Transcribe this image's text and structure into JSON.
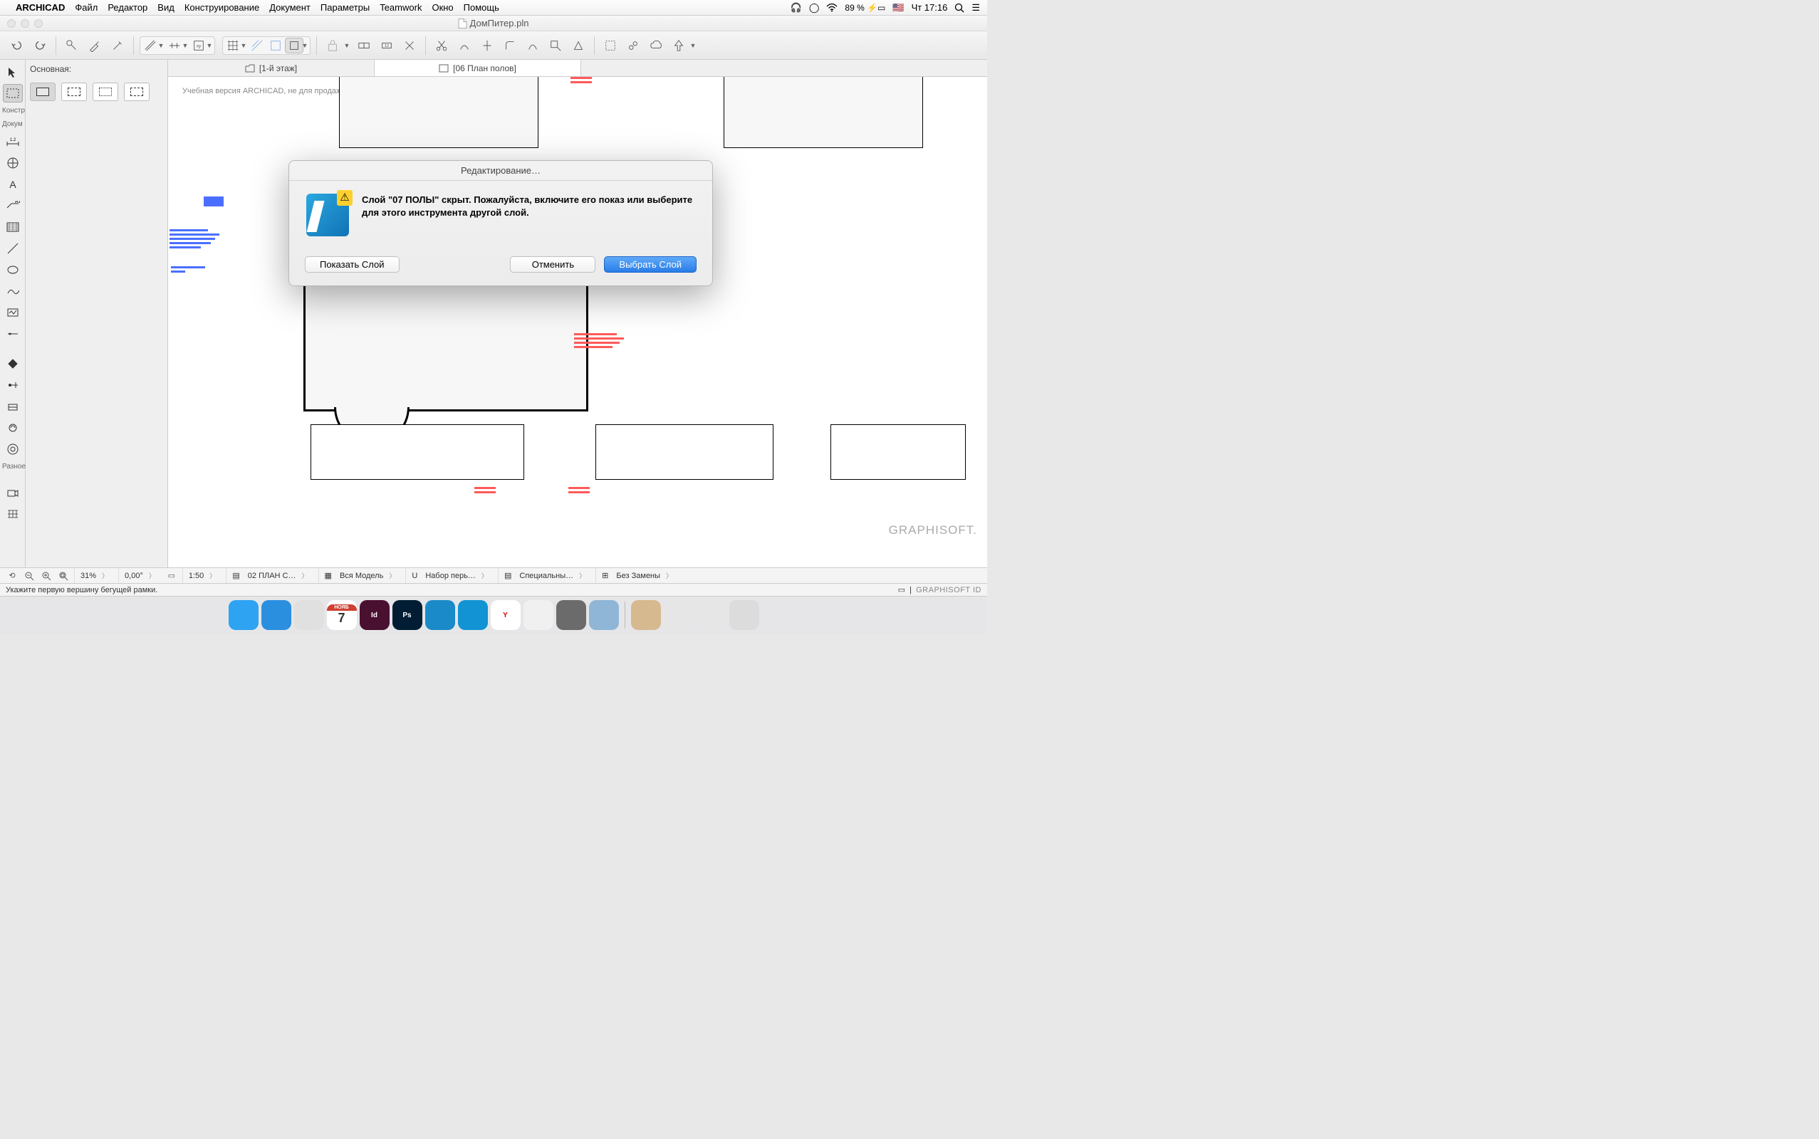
{
  "menubar": {
    "app": "ARCHICAD",
    "items": [
      "Файл",
      "Редактор",
      "Вид",
      "Конструирование",
      "Документ",
      "Параметры",
      "Teamwork",
      "Окно",
      "Помощь"
    ],
    "battery": "89 %",
    "clock": "Чт 17:16"
  },
  "window": {
    "title": "ДомПитер.pln"
  },
  "tabs": [
    {
      "icon": "folder-icon",
      "label": "[1-й этаж]"
    },
    {
      "icon": "sheet-icon",
      "label": "[06 План полов]"
    }
  ],
  "infobar": {
    "title": "Основная:"
  },
  "left_labels": {
    "constr": "Констр",
    "doc": "Докум",
    "misc": "Разное"
  },
  "canvas": {
    "watermark": "Учебная версия ARCHICAD, не для продажи. В порядке любезности GRAPHISOFT.",
    "graphisoft": "GRAPHISOFT."
  },
  "dialog": {
    "title": "Редактирование…",
    "message": "Слой \"07 ПОЛЫ\" скрыт. Пожалуйста, включите его показ или выберите для этого инструмента другой слой.",
    "btn_show": "Показать Слой",
    "btn_cancel": "Отменить",
    "btn_select": "Выбрать Слой"
  },
  "quickbar": {
    "zoom": "31%",
    "angle": "0,00°",
    "scale": "1:50",
    "layer": "02 ПЛАН С…",
    "model": "Вся Модель",
    "penset": "Набор перь…",
    "mvo": "Специальны…",
    "reno": "Без Замены"
  },
  "status": {
    "hint": "Укажите первую вершину бегущей рамки.",
    "id": "GRAPHISOFT ID"
  },
  "dock": {
    "items": [
      {
        "name": "finder",
        "bg": "#2ea3f2"
      },
      {
        "name": "safari",
        "bg": "#2b8fe0"
      },
      {
        "name": "mail",
        "bg": "#e0e0e0"
      },
      {
        "name": "calendar",
        "bg": "#e0503a",
        "label": "7",
        "sub": "НОЯБ"
      },
      {
        "name": "indesign",
        "bg": "#4a1030",
        "label": "Id"
      },
      {
        "name": "photoshop",
        "bg": "#001d33",
        "label": "Ps"
      },
      {
        "name": "archicad",
        "bg": "#1a8ac8"
      },
      {
        "name": "cinema4d",
        "bg": "#1293d4"
      },
      {
        "name": "yandex",
        "bg": "#ffffff",
        "label": "Y",
        "fg": "#d80000"
      },
      {
        "name": "photos",
        "bg": "#f0f0f0"
      },
      {
        "name": "settings",
        "bg": "#6b6b6b"
      },
      {
        "name": "preview",
        "bg": "#8fb6d6"
      },
      {
        "name": "folder1",
        "bg": "#d7b98f"
      },
      {
        "name": "folder2",
        "bg": "#e6e6e6"
      },
      {
        "name": "folder3",
        "bg": "#e6e6e6"
      },
      {
        "name": "trash",
        "bg": "#dcdcdc"
      }
    ]
  }
}
